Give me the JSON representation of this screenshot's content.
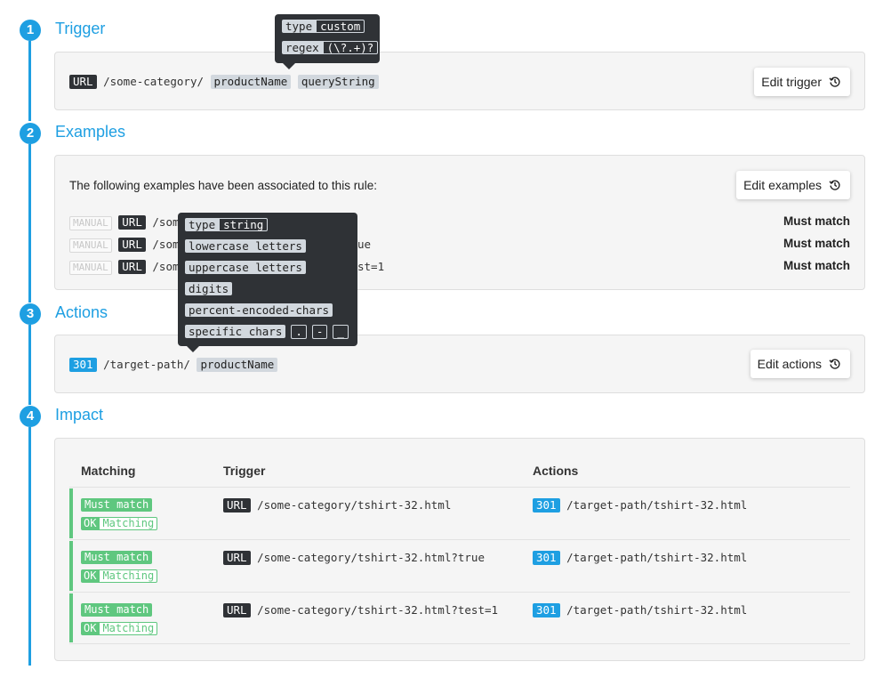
{
  "steps": [
    {
      "number": "1",
      "title": "Trigger"
    },
    {
      "number": "2",
      "title": "Examples"
    },
    {
      "number": "3",
      "title": "Actions"
    },
    {
      "number": "4",
      "title": "Impact"
    }
  ],
  "trigger": {
    "url_tag": "URL",
    "path": "/some-category/",
    "params": [
      "productName",
      "queryString"
    ],
    "edit_label": "Edit trigger",
    "tooltip": {
      "type_key": "type",
      "type_value": "custom",
      "regex_key": "regex",
      "regex_value": "(\\?.+)?"
    }
  },
  "examples": {
    "intro": "The following examples have been associated to this rule:",
    "edit_label": "Edit examples",
    "rows": [
      {
        "source": "MANUAL",
        "url_tag": "URL",
        "text_start": "/som",
        "text_end": "",
        "result": "Must match"
      },
      {
        "source": "MANUAL",
        "url_tag": "URL",
        "text_start": "/som",
        "text_end": "ue",
        "result": "Must match"
      },
      {
        "source": "MANUAL",
        "url_tag": "URL",
        "text_start": "/som",
        "text_end": "st=1",
        "result": "Must match"
      }
    ],
    "tooltip": {
      "type_key": "type",
      "type_value": "string",
      "options": [
        "lowercase letters",
        "uppercase letters",
        "digits",
        "percent-encoded-chars"
      ],
      "specific_label": "specific chars",
      "chars": [
        ".",
        "-",
        "_"
      ]
    }
  },
  "actions": {
    "code_tag": "301",
    "path": "/target-path/",
    "param": "productName",
    "edit_label": "Edit actions"
  },
  "impact": {
    "headers": {
      "matching": "Matching",
      "trigger": "Trigger",
      "actions": "Actions"
    },
    "rows": [
      {
        "must": "Must match",
        "ok": "OK",
        "matching": "Matching",
        "url_tag": "URL",
        "trigger": "/some-category/tshirt-32.html",
        "code": "301",
        "action": "/target-path/tshirt-32.html"
      },
      {
        "must": "Must match",
        "ok": "OK",
        "matching": "Matching",
        "url_tag": "URL",
        "trigger": "/some-category/tshirt-32.html?true",
        "code": "301",
        "action": "/target-path/tshirt-32.html"
      },
      {
        "must": "Must match",
        "ok": "OK",
        "matching": "Matching",
        "url_tag": "URL",
        "trigger": "/some-category/tshirt-32.html?test=1",
        "code": "301",
        "action": "/target-path/tshirt-32.html"
      }
    ]
  },
  "colors": {
    "accent": "#1e9fe2",
    "success": "#5fc77f",
    "dark": "#2f3236"
  }
}
